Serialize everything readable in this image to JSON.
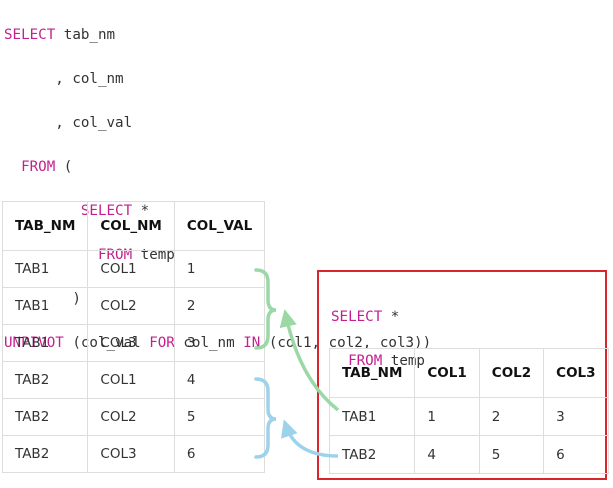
{
  "main_query": {
    "line1": {
      "kw": "SELECT",
      "rest": " tab_nm"
    },
    "line2": ", col_nm",
    "line3": ", col_val",
    "line4": {
      "kw": "FROM",
      "rest": " ("
    },
    "line5": {
      "kw": "SELECT",
      "rest": " *"
    },
    "line6": {
      "kw": "FROM",
      "rest": " temp"
    },
    "line7": ")",
    "line8": {
      "kw1": "UNPIVOT",
      "t1": " (col_val ",
      "kw2": "FOR",
      "t2": " col_nm ",
      "kw3": "IN",
      "t3": " (col1, col2, col3))"
    }
  },
  "result_table": {
    "headers": [
      "TAB_NM",
      "COL_NM",
      "COL_VAL"
    ],
    "rows": [
      [
        "TAB1",
        "COL1",
        "1"
      ],
      [
        "TAB1",
        "COL2",
        "2"
      ],
      [
        "TAB1",
        "COL3",
        "3"
      ],
      [
        "TAB2",
        "COL1",
        "4"
      ],
      [
        "TAB2",
        "COL2",
        "5"
      ],
      [
        "TAB2",
        "COL3",
        "6"
      ]
    ]
  },
  "source_box": {
    "line1": {
      "kw": "SELECT",
      "rest": " *"
    },
    "line2": {
      "kw": "FROM",
      "rest": " temp"
    },
    "table": {
      "headers": [
        "TAB_NM",
        "COL1",
        "COL2",
        "COL3"
      ],
      "rows": [
        [
          "TAB1",
          "1",
          "2",
          "3"
        ],
        [
          "TAB2",
          "4",
          "5",
          "6"
        ]
      ]
    }
  },
  "colors": {
    "keyword": "#c31f8f",
    "text": "#333333",
    "box_border": "#d9262c",
    "tab1_arrow": "#9ad8a6",
    "tab2_arrow": "#9dd3ea"
  }
}
